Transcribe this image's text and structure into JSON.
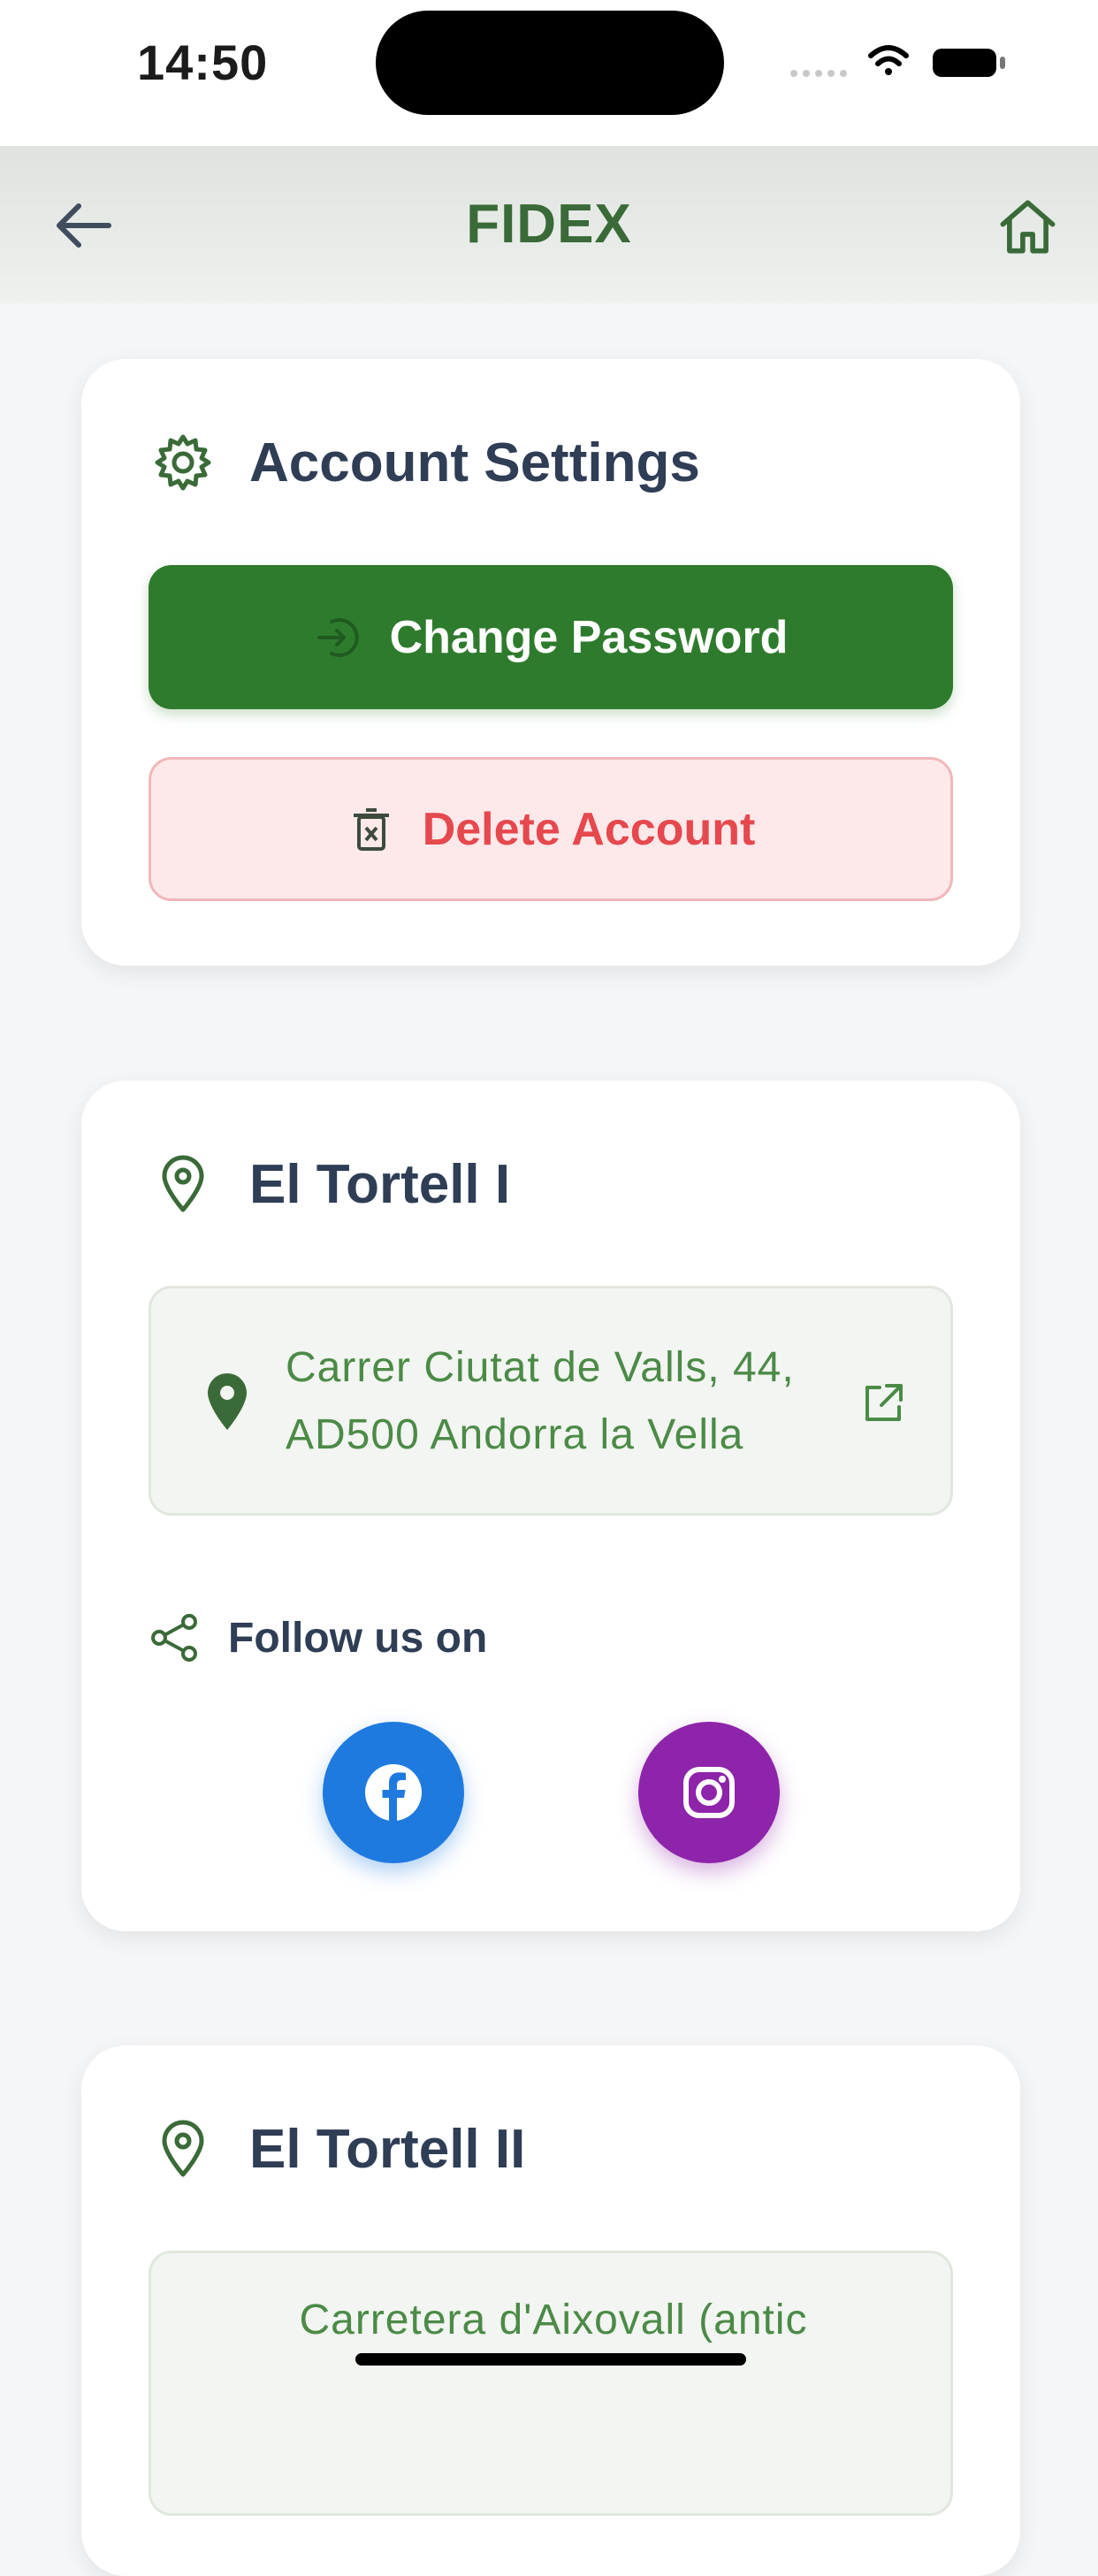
{
  "status_bar": {
    "time": "14:50"
  },
  "app_bar": {
    "title": "FIDEX",
    "back_icon": "arrow-left-icon",
    "home_icon": "home-icon"
  },
  "account": {
    "title": "Account Settings",
    "icon": "gear-icon",
    "change_password_label": "Change Password",
    "delete_account_label": "Delete Account"
  },
  "locations": [
    {
      "title": "El Tortell I",
      "address_line1": "Carrer Ciutat de Valls, 44,",
      "address_line2": "AD500 Andorra la Vella",
      "follow_label": "Follow us on"
    },
    {
      "title": "El Tortell II",
      "address_line1": "Carretera d'Aixovall (antic"
    }
  ],
  "colors": {
    "primary": "#2e7b2d",
    "danger": "#e5484d",
    "facebook": "#1f7ae0",
    "instagram": "#8e24aa",
    "title": "#2f3d55"
  }
}
